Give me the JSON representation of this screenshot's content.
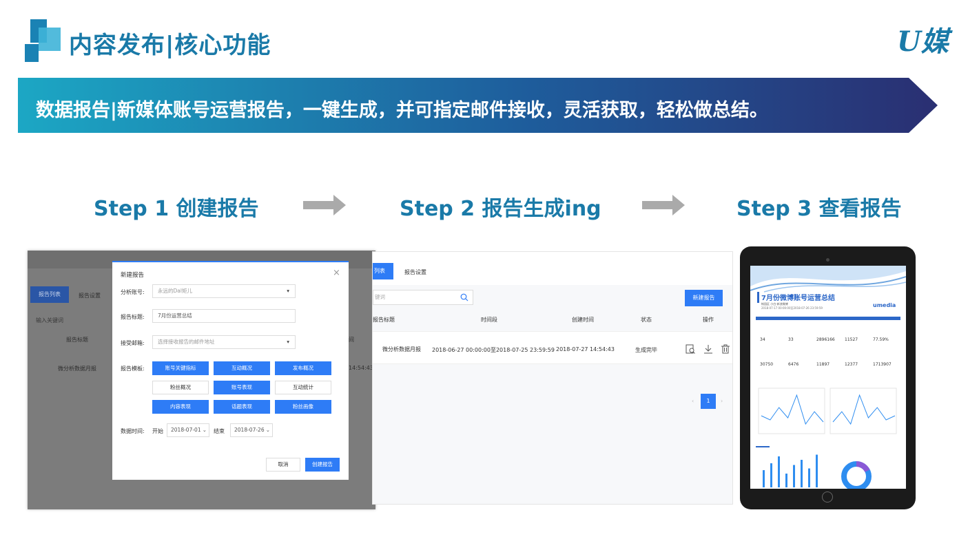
{
  "header": {
    "title": "内容发布|核心功能",
    "brand": "U媒"
  },
  "banner": {
    "text": "数据报告|新媒体账号运营报告，一键生成，并可指定邮件接收，灵活获取，轻松做总结。"
  },
  "steps": [
    {
      "label": "Step 1 创建报告"
    },
    {
      "label": "Step 2 报告生成ing"
    },
    {
      "label": "Step 3 查看报告"
    }
  ],
  "screen1": {
    "tabs": [
      "报告列表",
      "报告设置"
    ],
    "search_placeholder": "输入关键词",
    "col_title": "报告标题",
    "col_cut": "间",
    "row_title": "微分析数据月报",
    "row_cut": "14:54:43",
    "modal": {
      "title": "新建报告",
      "close": "×",
      "account_label": "分析账号:",
      "account_value": "永远的Dal矩儿",
      "title_label": "报告标题:",
      "title_value": "7月份运营总结",
      "email_label": "接受邮箱:",
      "email_placeholder": "选择接收报告的邮件地址",
      "template_label": "报告模板:",
      "templates": [
        "账号关键指标",
        "互动概况",
        "发布概况",
        "粉丝概况",
        "账号表现",
        "互动统计",
        "内容表现",
        "话题表现",
        "粉丝画像"
      ],
      "time_label": "数据时间:",
      "start_label": "开始",
      "start_value": "2018-07-01",
      "end_label": "结束",
      "end_value": "2018-07-26",
      "cancel": "取消",
      "create": "创建报告"
    }
  },
  "screen2": {
    "tabs": [
      "列表",
      "报告设置"
    ],
    "search_placeholder": "键词",
    "new_button": "新建报告",
    "columns": [
      "报告标题",
      "时间段",
      "创建时间",
      "状态",
      "操作"
    ],
    "row": {
      "title": "微分析数据月报",
      "period": "2018-06-27 00:00:00至2018-07-25 23:59:59",
      "created": "2018-07-27 14:54:43",
      "status": "生成完毕"
    },
    "pagination": {
      "prev": "‹",
      "current": "1",
      "next": "›"
    }
  },
  "screen3": {
    "report_title": "7月份微博账号运营总结",
    "account": "帐园区 小白-新浪微博",
    "range": "2018-07-17 00:00:00至2018-07-26 23:59:59",
    "brand": "umedia",
    "stats_row1": [
      "34",
      "33",
      "2896166",
      "11527",
      "77.59%"
    ],
    "stats_row2": [
      "30750",
      "6476",
      "11897",
      "12377",
      "1713907"
    ],
    "chart_line_values": [
      40,
      30,
      60,
      35,
      90,
      20,
      50,
      25
    ],
    "chart_bar_values": [
      50,
      70,
      90,
      40,
      65,
      80,
      55,
      95
    ]
  },
  "colors": {
    "accent": "#1a7aa8",
    "button": "#2e7cf6"
  }
}
